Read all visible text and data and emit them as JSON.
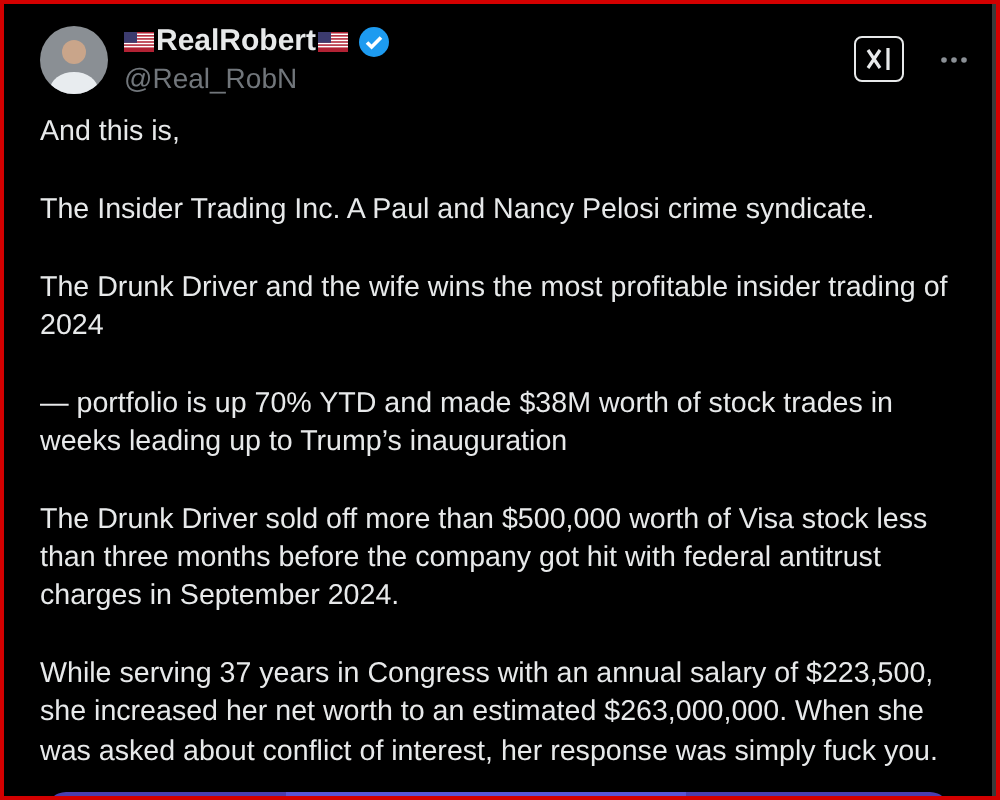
{
  "author": {
    "name": "RealRobert",
    "handle": "@Real_RobN",
    "verified": true
  },
  "paragraphs": [
    "And this is,",
    "The Insider Trading Inc. A Paul and Nancy Pelosi crime syndicate.",
    "The Drunk Driver and the wife wins the most profitable insider trading of 2024",
    "— portfolio is up 70% YTD and made $38M worth of stock trades in weeks leading up to Trump’s inauguration",
    "The Drunk Driver sold off more than $500,000 worth of Visa stock less than three months before the company got hit with federal antitrust charges in September 2024.",
    "While serving 37 years in Congress with an annual salary of $223,500, she increased her net worth to an estimated $263,000,000. When she was asked about conflict of interest, her response was simply fuck you."
  ]
}
